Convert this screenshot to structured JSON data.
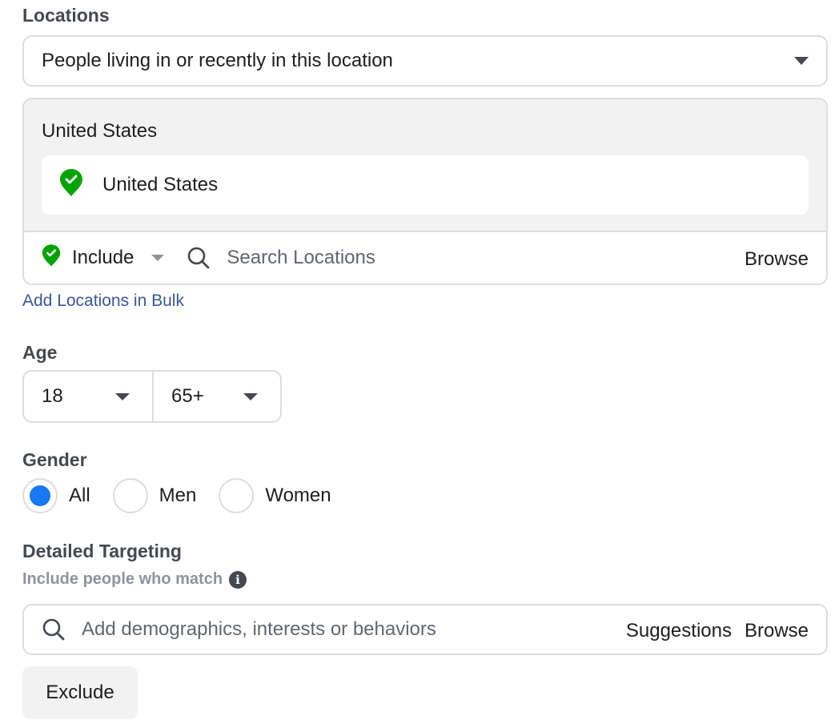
{
  "locations": {
    "label": "Locations",
    "mode_selected": "People living in or recently in this location",
    "group_title": "United States",
    "selected": [
      {
        "name": "United States",
        "icon": "location-pin-check-icon"
      }
    ],
    "include_label": "Include",
    "search_placeholder": "Search Locations",
    "browse_label": "Browse",
    "bulk_link": "Add Locations in Bulk"
  },
  "age": {
    "label": "Age",
    "min": "18",
    "max": "65+"
  },
  "gender": {
    "label": "Gender",
    "options": [
      {
        "label": "All",
        "selected": true
      },
      {
        "label": "Men",
        "selected": false
      },
      {
        "label": "Women",
        "selected": false
      }
    ]
  },
  "detailed_targeting": {
    "label": "Detailed Targeting",
    "sublabel": "Include people who match",
    "info_icon": "info-icon",
    "search_placeholder": "Add demographics, interests or behaviors",
    "suggestions_label": "Suggestions",
    "browse_label": "Browse",
    "exclude_label": "Exclude"
  },
  "colors": {
    "accent": "#1877f2",
    "pin_green": "#00a400",
    "link": "#385898",
    "border": "#dadde1"
  }
}
